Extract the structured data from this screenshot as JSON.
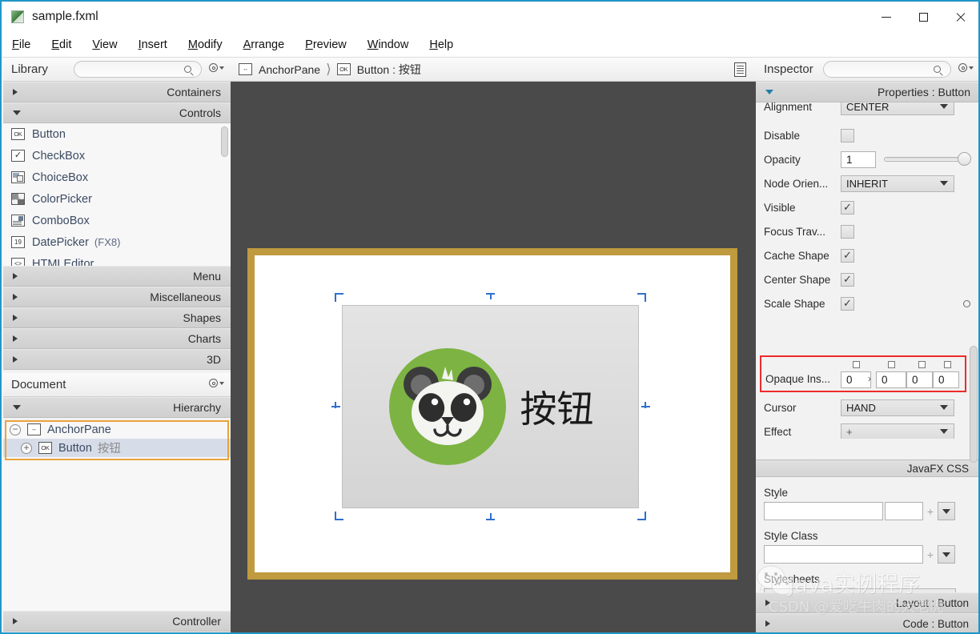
{
  "window": {
    "title": "sample.fxml",
    "icon": "fxml-file-icon",
    "minimize": "minimize-icon",
    "maximize": "maximize-icon",
    "close": "close-icon"
  },
  "menubar": {
    "items": [
      {
        "label": "File",
        "mnemonic": "F"
      },
      {
        "label": "Edit",
        "mnemonic": "E"
      },
      {
        "label": "View",
        "mnemonic": "V"
      },
      {
        "label": "Insert",
        "mnemonic": "I"
      },
      {
        "label": "Modify",
        "mnemonic": "M"
      },
      {
        "label": "Arrange",
        "mnemonic": "A"
      },
      {
        "label": "Preview",
        "mnemonic": "P"
      },
      {
        "label": "Window",
        "mnemonic": "W"
      },
      {
        "label": "Help",
        "mnemonic": "H"
      }
    ]
  },
  "library": {
    "title": "Library",
    "search_placeholder": "",
    "search_value": "",
    "sections": [
      {
        "label": "Containers",
        "expanded": false
      },
      {
        "label": "Controls",
        "expanded": true
      }
    ],
    "controls": [
      {
        "label": "Button",
        "suffix": "",
        "icon": "button-icon"
      },
      {
        "label": "CheckBox",
        "suffix": "",
        "icon": "checkbox-icon"
      },
      {
        "label": "ChoiceBox",
        "suffix": "",
        "icon": "choicebox-icon"
      },
      {
        "label": "ColorPicker",
        "suffix": "",
        "icon": "colorpicker-icon"
      },
      {
        "label": "ComboBox",
        "suffix": "",
        "icon": "combobox-icon"
      },
      {
        "label": "DatePicker",
        "suffix": "(FX8)",
        "icon": "datepicker-icon"
      },
      {
        "label": "HTMLEditor",
        "suffix": "",
        "icon": "htmleditor-icon"
      }
    ],
    "bottom_sections": [
      {
        "label": "Menu"
      },
      {
        "label": "Miscellaneous"
      },
      {
        "label": "Shapes"
      },
      {
        "label": "Charts"
      },
      {
        "label": "3D"
      }
    ]
  },
  "document": {
    "title": "Document",
    "hierarchy_label": "Hierarchy",
    "nodes": [
      {
        "name": "AnchorPane",
        "class_label": "",
        "icon": "anchorpane-icon",
        "expander": "collapse",
        "selected": false
      },
      {
        "name": "Button",
        "class_label": "按钮",
        "icon": "button-icon",
        "expander": "expand",
        "selected": true
      }
    ],
    "controller_label": "Controller"
  },
  "content": {
    "breadcrumb": [
      {
        "icon": "anchorpane-icon",
        "label": "AnchorPane"
      },
      {
        "icon": "button-icon",
        "label": "Button : 按钮"
      }
    ],
    "doc_icon": "document-icon",
    "button": {
      "text": "按钮",
      "graphic": "panda-icon"
    },
    "colors": {
      "canvas_bg": "#4a4a4a",
      "pane_border": "#bf9a3e",
      "pane_bg": "#ffffff",
      "button_bg": "#dcdcdc",
      "selection_handle": "#2f6fd0",
      "panda_green": "#7cb342"
    }
  },
  "inspector": {
    "title": "Inspector",
    "search_value": "",
    "section_label": "Properties : Button",
    "properties": [
      {
        "label": "Alignment",
        "type": "combo",
        "value": "CENTER"
      },
      {
        "label": "Disable",
        "type": "checkbox",
        "checked": false
      },
      {
        "label": "Opacity",
        "type": "number_slider",
        "value": "1",
        "slider_pct": 100
      },
      {
        "label": "Node Orien...",
        "type": "combo",
        "value": "INHERIT"
      },
      {
        "label": "Visible",
        "type": "checkbox",
        "checked": true
      },
      {
        "label": "Focus Trav...",
        "type": "checkbox",
        "checked": false
      },
      {
        "label": "Cache Shape",
        "type": "checkbox",
        "checked": true
      },
      {
        "label": "Center Shape",
        "type": "checkbox",
        "checked": true
      },
      {
        "label": "Scale Shape",
        "type": "checkbox",
        "checked": true
      }
    ],
    "opaque_insets": {
      "label": "Opaque Ins...",
      "values": [
        "0",
        "0",
        "0",
        "0"
      ],
      "checked": [
        false,
        false,
        false,
        false
      ],
      "separator": "›",
      "highlight_color": "#ee2b2b"
    },
    "cursor": {
      "label": "Cursor",
      "value": "HAND"
    },
    "effect": {
      "label": "Effect",
      "value": "+"
    },
    "css": {
      "header": "JavaFX CSS",
      "style_label": "Style",
      "style_value": "",
      "style_value2": "",
      "style_class_label": "Style Class",
      "style_class_value": "",
      "stylesheets_label": "Stylesheets",
      "stylesheets_add": "+"
    },
    "bottom_sections": [
      {
        "label": "Layout : Button"
      },
      {
        "label": "Code : Button"
      }
    ]
  },
  "watermark": {
    "line1": "Java实例程序",
    "line2": "CSDN @爱吃牛肉的大老虎",
    "icon": "wechat-icon"
  }
}
